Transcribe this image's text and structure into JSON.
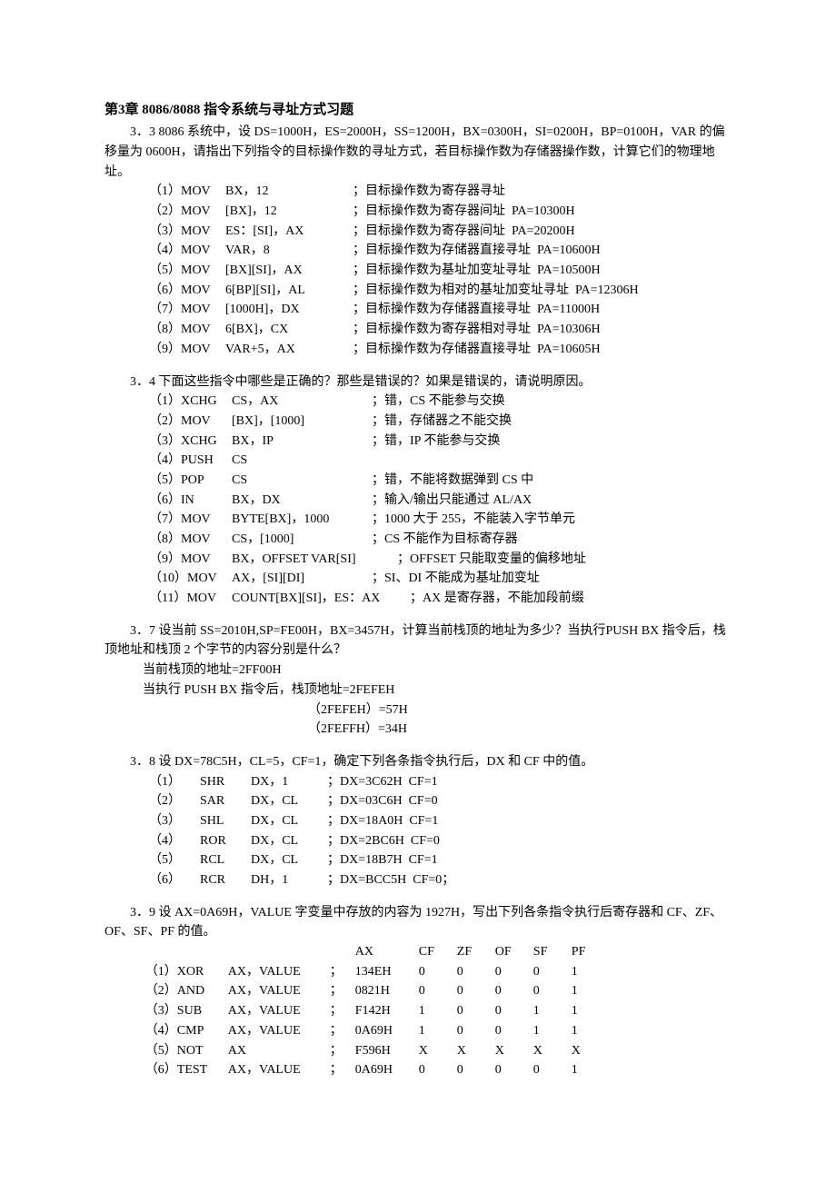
{
  "chapter_title": "第3章   8086/8088 指令系统与寻址方式习题",
  "q33": {
    "intro": "3．3  8086 系统中，设 DS=1000H，ES=2000H，SS=1200H，BX=0300H，SI=0200H，BP=0100H，VAR 的偏移量为 0600H，请指出下列指令的目标操作数的寻址方式，若目标操作数为存储器操作数，计算它们的物理地址。",
    "rows": [
      {
        "n": "（1）MOV",
        "code": "BX，12",
        "cmt": "；目标操作数为寄存器寻址"
      },
      {
        "n": "（2）MOV",
        "code": "[BX]，12",
        "cmt": "；目标操作数为寄存器间址  PA=10300H"
      },
      {
        "n": "（3）MOV",
        "code": "ES：[SI]，AX",
        "cmt": "；目标操作数为寄存器间址  PA=20200H"
      },
      {
        "n": "（4）MOV",
        "code": "VAR，8",
        "cmt": "；目标操作数为存储器直接寻址  PA=10600H"
      },
      {
        "n": "（5）MOV",
        "code": "[BX][SI]，AX",
        "cmt": "；目标操作数为基址加变址寻址  PA=10500H"
      },
      {
        "n": "（6）MOV",
        "code": "6[BP][SI]，AL",
        "cmt": "；目标操作数为相对的基址加变址寻址  PA=12306H"
      },
      {
        "n": "（7）MOV",
        "code": "[1000H]，DX",
        "cmt": "；目标操作数为存储器直接寻址  PA=11000H"
      },
      {
        "n": "（8）MOV",
        "code": "6[BX]，CX",
        "cmt": "；目标操作数为寄存器相对寻址  PA=10306H"
      },
      {
        "n": "（9）MOV",
        "code": "VAR+5，AX",
        "cmt": "；目标操作数为存储器直接寻址  PA=10605H"
      }
    ]
  },
  "q34": {
    "intro": "3．4  下面这些指令中哪些是正确的？那些是错误的？如果是错误的，请说明原因。",
    "rows": [
      {
        "n": "（1）XCHG",
        "code": "CS，AX",
        "cmt": "；错，CS 不能参与交换"
      },
      {
        "n": "（2）MOV",
        "code": "[BX]，[1000]",
        "cmt": "；错，存储器之不能交换"
      },
      {
        "n": "（3）XCHG",
        "code": "BX，IP",
        "cmt": "；错，IP 不能参与交换"
      },
      {
        "n": "（4）PUSH",
        "code": "CS",
        "cmt": ""
      },
      {
        "n": "（5）POP",
        "code": "CS",
        "cmt": "；错，不能将数据弹到 CS 中"
      },
      {
        "n": "（6）IN",
        "code": "BX，DX",
        "cmt": "；输入/输出只能通过 AL/AX"
      },
      {
        "n": "（7）MOV",
        "code": "BYTE[BX]，1000",
        "cmt": "；1000 大于 255，不能装入字节单元"
      },
      {
        "n": "（8）MOV",
        "code": "CS，[1000]",
        "cmt": "；CS 不能作为目标寄存器"
      },
      {
        "n": "（9）MOV",
        "code": "BX，OFFSET VAR[SI]",
        "cmt": "；OFFSET 只能取变量的偏移地址"
      },
      {
        "n": "（10）MOV",
        "code": "AX，[SI][DI]",
        "cmt": "；SI、DI 不能成为基址加变址"
      },
      {
        "n": "（11）MOV",
        "code": "COUNT[BX][SI]，ES：AX",
        "cmt": "；AX 是寄存器，不能加段前缀"
      }
    ]
  },
  "q37": {
    "intro": "3．7  设当前 SS=2010H,SP=FE00H，BX=3457H，计算当前栈顶的地址为多少？当执行PUSH  BX 指令后，栈顶地址和栈顶 2 个字节的内容分别是什么？",
    "a1": "当前栈顶的地址=2FF00H",
    "a2": "当执行 PUSH  BX  指令后，栈顶地址=2FEFEH",
    "a3": "（2FEFEH）=57H",
    "a4": "（2FEFFH）=34H"
  },
  "q38": {
    "intro": "3．8  设 DX=78C5H，CL=5，CF=1，确定下列各条指令执行后，DX 和 CF 中的值。",
    "rows": [
      {
        "n": "（1）",
        "op": "SHR",
        "code": "DX，1",
        "cmt": "；DX=3C62H  CF=1"
      },
      {
        "n": "（2）",
        "op": "SAR",
        "code": "DX，CL",
        "cmt": "；DX=03C6H  CF=0"
      },
      {
        "n": "（3）",
        "op": "SHL",
        "code": "DX，CL",
        "cmt": "；DX=18A0H  CF=1"
      },
      {
        "n": "（4）",
        "op": "ROR",
        "code": "DX，CL",
        "cmt": "；DX=2BC6H  CF=0"
      },
      {
        "n": "（5）",
        "op": "RCL",
        "code": "DX，CL",
        "cmt": "；DX=18B7H  CF=1"
      },
      {
        "n": "（6）",
        "op": "RCR",
        "code": "DH，1",
        "cmt": "；DX=BCC5H  CF=0；"
      }
    ]
  },
  "q39": {
    "intro": "3．9  设 AX=0A69H，VALUE 字变量中存放的内容为 1927H，写出下列各条指令执行后寄存器和 CF、ZF、OF、SF、PF 的值。",
    "header": {
      "c0": "",
      "c1": "",
      "c2": "",
      "ax": "AX",
      "cf": "CF",
      "zf": "ZF",
      "of": "OF",
      "sf": "SF",
      "pf": "PF"
    },
    "rows": [
      {
        "n": "（1）XOR",
        "op": "AX，VALUE",
        "sep": "；",
        "ax": "134EH",
        "cf": "0",
        "zf": "0",
        "of": "0",
        "sf": "0",
        "pf": "1"
      },
      {
        "n": "（2）AND",
        "op": "AX，VALUE",
        "sep": "；",
        "ax": "0821H",
        "cf": "0",
        "zf": "0",
        "of": "0",
        "sf": "0",
        "pf": "1"
      },
      {
        "n": "（3）SUB",
        "op": "AX，VALUE",
        "sep": "；",
        "ax": "F142H",
        "cf": "1",
        "zf": "0",
        "of": "0",
        "sf": "1",
        "pf": "1"
      },
      {
        "n": "（4）CMP",
        "op": "AX，VALUE",
        "sep": "；",
        "ax": "0A69H",
        "cf": "1",
        "zf": "0",
        "of": "0",
        "sf": "1",
        "pf": "1"
      },
      {
        "n": "（5）NOT",
        "op": "AX",
        "sep": "；",
        "ax": "F596H",
        "cf": "X",
        "zf": "X",
        "of": "X",
        "sf": "X",
        "pf": "X"
      },
      {
        "n": "（6）TEST",
        "op": "AX，VALUE",
        "sep": "；",
        "ax": "0A69H",
        "cf": "0",
        "zf": "0",
        "of": "0",
        "sf": "0",
        "pf": "1"
      }
    ]
  }
}
